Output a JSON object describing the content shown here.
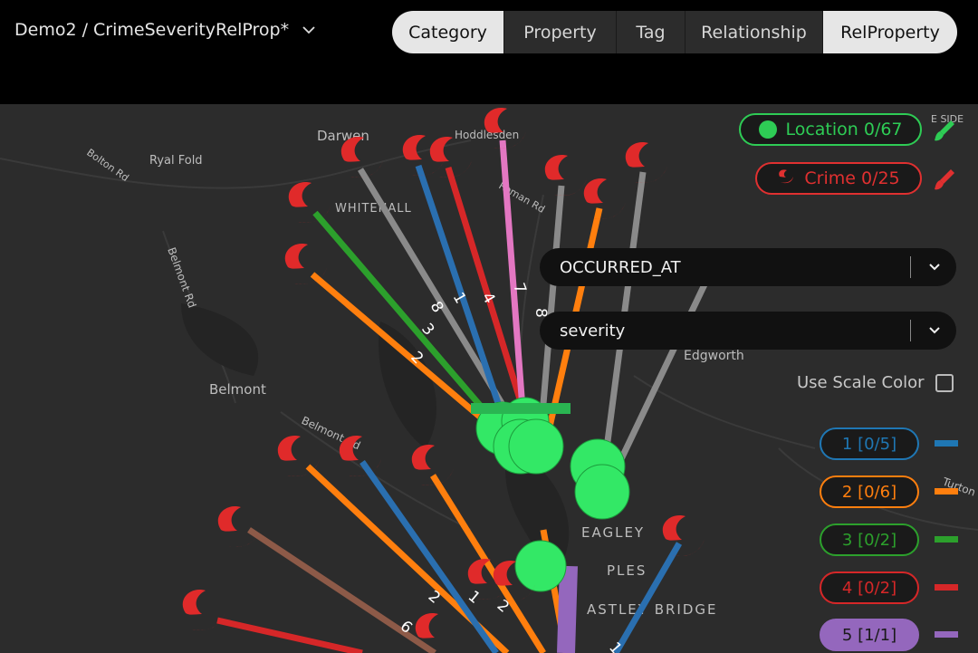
{
  "header": {
    "breadcrumb": "Demo2 / CrimeSeverityRelProp*",
    "tabs": [
      {
        "label": "Category",
        "active": true
      },
      {
        "label": "Property",
        "active": false
      },
      {
        "label": "Tag",
        "active": false
      },
      {
        "label": "Relationship",
        "active": false
      },
      {
        "label": "RelProperty",
        "active": true
      }
    ]
  },
  "map": {
    "place_labels": [
      "Darwen",
      "Hoddlesden",
      "Ryal Fold",
      "Bolton Rd",
      "WHITEHALL",
      "Roman Rd",
      "Belmont Rd",
      "Belmont",
      "Belmont Rd",
      "Edgworth",
      "EAGLEY",
      "ASTLEY BRIDGE",
      "PLES",
      "E SIDE",
      "Turton"
    ],
    "edge_labels": [
      "8",
      "1",
      "4",
      "7",
      "8",
      "3",
      "2",
      "2",
      "1",
      "2",
      "6",
      "1"
    ]
  },
  "categories": [
    {
      "label": "Location 0/67",
      "color": "#2ecc55"
    },
    {
      "label": "Crime 0/25",
      "color": "#e03030"
    }
  ],
  "relationship_select": {
    "value": "OCCURRED_AT"
  },
  "property_select": {
    "value": "severity"
  },
  "scale_color": {
    "label": "Use Scale Color",
    "checked": false
  },
  "severity_legend": [
    {
      "label": "1 [0/5]",
      "color": "#1f77b4"
    },
    {
      "label": "2 [0/6]",
      "color": "#ff7f0e"
    },
    {
      "label": "3 [0/2]",
      "color": "#2ca02c"
    },
    {
      "label": "4 [0/2]",
      "color": "#d62728"
    },
    {
      "label": "5 [1/1]",
      "color": "#9467bd"
    }
  ]
}
